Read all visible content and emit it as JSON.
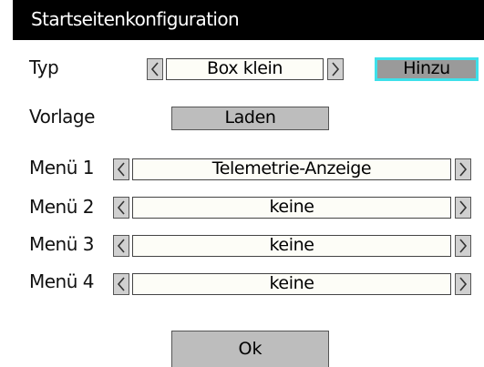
{
  "title": "Startseitenkonfiguration",
  "typ": {
    "label": "Typ",
    "value": "Box klein",
    "add_button": "Hinzu"
  },
  "vorlage": {
    "label": "Vorlage",
    "button": "Laden"
  },
  "menus": [
    {
      "label": "Menü 1",
      "value": "Telemetrie-Anzeige"
    },
    {
      "label": "Menü 2",
      "value": "keine"
    },
    {
      "label": "Menü 3",
      "value": "keine"
    },
    {
      "label": "Menü 4",
      "value": "keine"
    }
  ],
  "ok_button": "Ok",
  "colors": {
    "title_bg": "#000000",
    "focus_border": "#3ee0ea",
    "button_bg": "#bdbdbd"
  }
}
